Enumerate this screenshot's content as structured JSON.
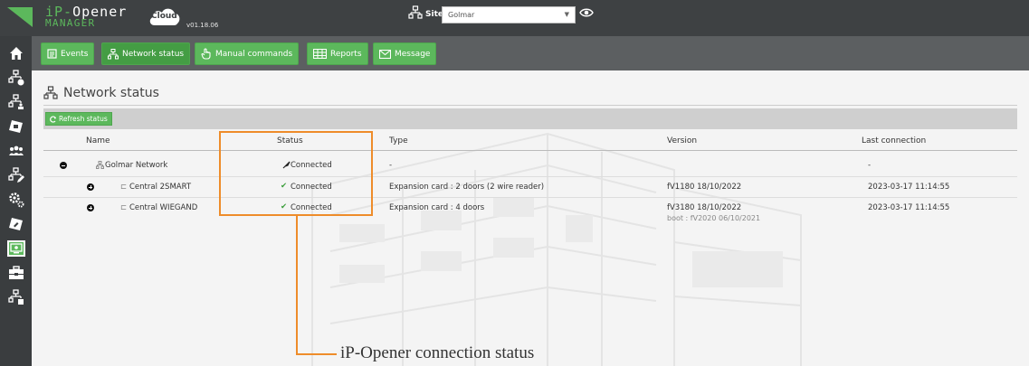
{
  "app": {
    "brand_line1_ip": "iP-",
    "brand_line1_rest": "Opener",
    "brand_line2": "MANAGER",
    "cloud_label": "Cloud",
    "version": "v01.18.06",
    "site_label": "Site",
    "site_value": "Golmar"
  },
  "navbar": {
    "events": "Events",
    "network_status": "Network status",
    "manual_commands": "Manual commands",
    "reports": "Reports",
    "message": "Message"
  },
  "page": {
    "title": "Network status",
    "refresh_label": "Refresh status"
  },
  "table": {
    "headers": {
      "name": "Name",
      "status": "Status",
      "type": "Type",
      "version": "Version",
      "last_connection": "Last connection"
    },
    "rows": [
      {
        "name": "Golmar Network",
        "status": "Connected",
        "type": "-",
        "version": "",
        "version_sub": "",
        "last_connection": "-"
      },
      {
        "name": "Central 2SMART",
        "status": "Connected",
        "type": "Expansion card : 2 doors (2 wire reader)",
        "version": "fV1180 18/10/2022",
        "version_sub": "",
        "last_connection": "2023-03-17 11:14:55"
      },
      {
        "name": "Central WIEGAND",
        "status": "Connected",
        "type": "Expansion card : 4 doors",
        "version": "fV3180 18/10/2022",
        "version_sub": "boot : fV2020 06/10/2021",
        "last_connection": "2023-03-17 11:14:55"
      }
    ]
  },
  "annotation": {
    "label": "iP-Opener connection status"
  },
  "colors": {
    "accent_green": "#5cb85c",
    "topbar": "#3e4143",
    "annotation_orange": "#ee8c2a"
  },
  "icons": {
    "sidebar": [
      "home-icon",
      "network-add-icon",
      "network-user-icon",
      "badge-icon",
      "users-icon",
      "network-edit-icon",
      "settings-icon",
      "badge-edit-icon",
      "monitor-icon",
      "toolbox-icon",
      "network-delete-icon"
    ]
  }
}
